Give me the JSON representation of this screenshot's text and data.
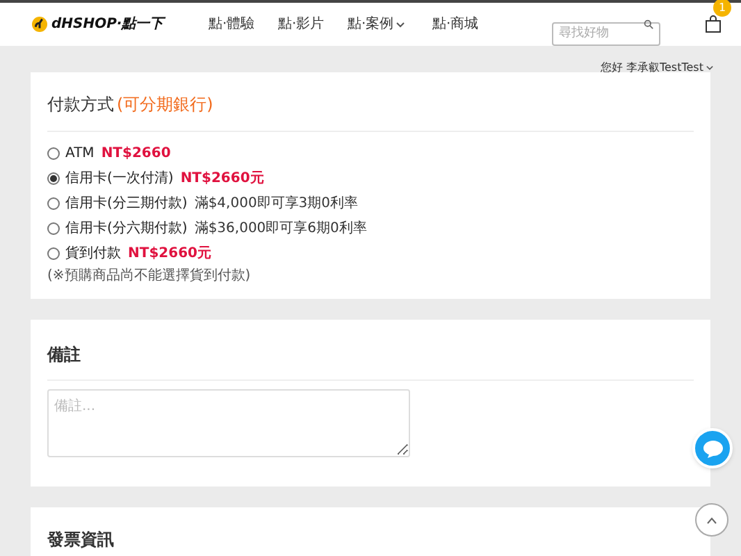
{
  "header": {
    "logo_text": "dHSHOP·點一下",
    "nav": [
      {
        "label": "點·體驗",
        "dropdown": false
      },
      {
        "label": "點·影片",
        "dropdown": false
      },
      {
        "label": "點·案例",
        "dropdown": true
      },
      {
        "label": "點·商城",
        "dropdown": false
      }
    ],
    "search": {
      "placeholder": "尋找好物"
    },
    "cart_count": "1"
  },
  "greeting": "您好 李承叡TestTest",
  "payment": {
    "title": "付款方式",
    "title_note": "(可分期銀行)",
    "options": [
      {
        "label": "ATM",
        "note": "NT$2660",
        "kind": "price",
        "selected": false
      },
      {
        "label": "信用卡(一次付清)",
        "note": "NT$2660元",
        "kind": "price",
        "selected": true
      },
      {
        "label": "信用卡(分三期付款)",
        "note": "滿$4,000即可享3期0利率",
        "kind": "info",
        "selected": false
      },
      {
        "label": "信用卡(分六期付款)",
        "note": "滿$36,000即可享6期0利率",
        "kind": "info",
        "selected": false
      },
      {
        "label": "貨到付款",
        "note": "NT$2660元",
        "kind": "price",
        "selected": false
      }
    ],
    "footnote": "(※預購商品尚不能選擇貨到付款)"
  },
  "remarks": {
    "title": "備註",
    "placeholder": "備註..."
  },
  "invoice": {
    "title": "發票資訊"
  }
}
